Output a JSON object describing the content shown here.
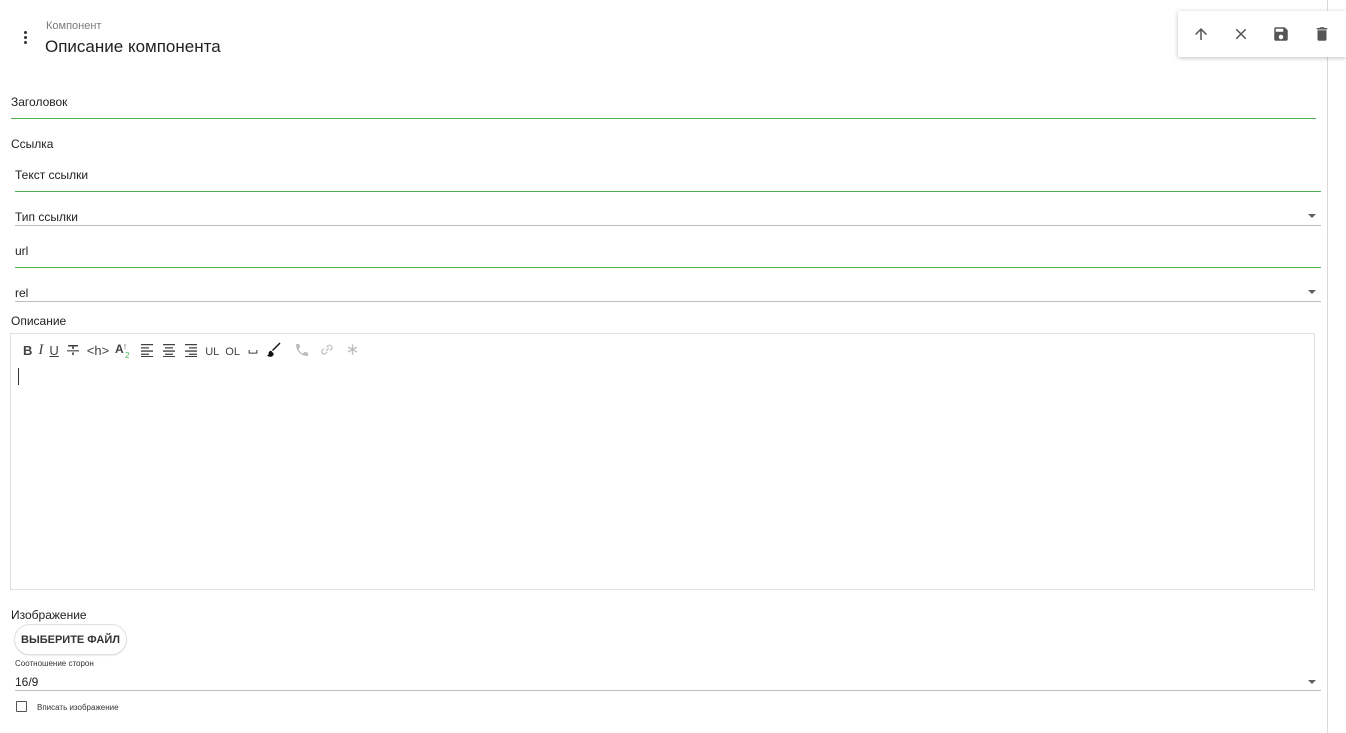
{
  "header": {
    "breadcrumb": "Компонент",
    "title": "Описание компонента"
  },
  "toolbar": {
    "icons": [
      "arrow-up-icon",
      "close-icon",
      "save-icon",
      "delete-icon"
    ]
  },
  "form": {
    "heading_label": "Заголовок",
    "link_section_label": "Ссылка",
    "link_text_label": "Текст ссылки",
    "link_type_label": "Тип ссылки",
    "url_label": "url",
    "rel_label": "rel",
    "description_label": "Описание",
    "image_label": "Изображение",
    "choose_file_label": "ВЫБЕРИТЕ ФАЙЛ",
    "aspect_ratio_label": "Соотношение сторон",
    "aspect_ratio_value": "16/9",
    "fit_image_label": "Вписать изображение"
  },
  "editor": {
    "tools": {
      "bold": "B",
      "italic": "I",
      "underline": "U",
      "heading": "<h>",
      "ul": "UL",
      "ol": "OL"
    }
  },
  "colors": {
    "accent_green": "#4caf50",
    "line_gray": "#bdbdbd",
    "disabled_icon": "#bdbdbd"
  }
}
